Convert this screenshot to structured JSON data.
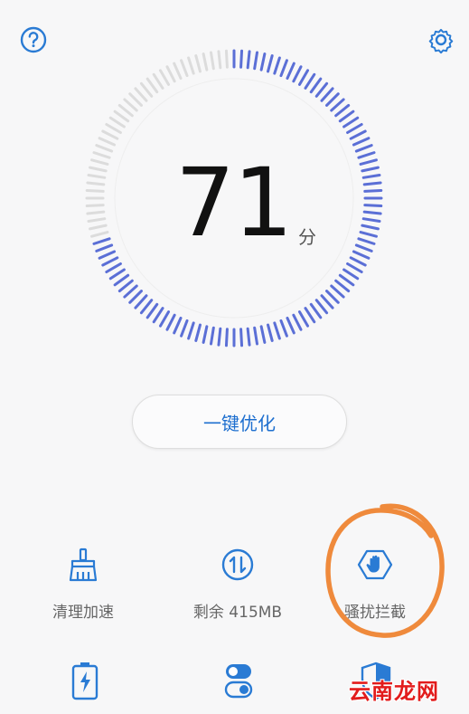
{
  "top_bar": {
    "help_icon": "question-circle-icon",
    "settings_icon": "gear-icon"
  },
  "score": {
    "value": "71",
    "unit": "分",
    "max": 100
  },
  "optimize_button": {
    "label": "一键优化"
  },
  "tools": [
    {
      "label": "清理加速",
      "icon": "broom-icon"
    },
    {
      "label": "剩余 415MB",
      "icon": "transfer-arrows-icon"
    },
    {
      "label": "骚扰拦截",
      "icon": "hand-stop-icon"
    }
  ],
  "tools_row2": [
    {
      "icon": "battery-icon"
    },
    {
      "icon": "toggle-switches-icon"
    },
    {
      "icon": "shield-icon"
    }
  ],
  "watermark": "云南龙网",
  "colors": {
    "accent": "#1e6fcf",
    "gauge_active": "#5b6fd6",
    "gauge_inactive": "#dcdcdc",
    "annotation": "#ef8a3c"
  }
}
